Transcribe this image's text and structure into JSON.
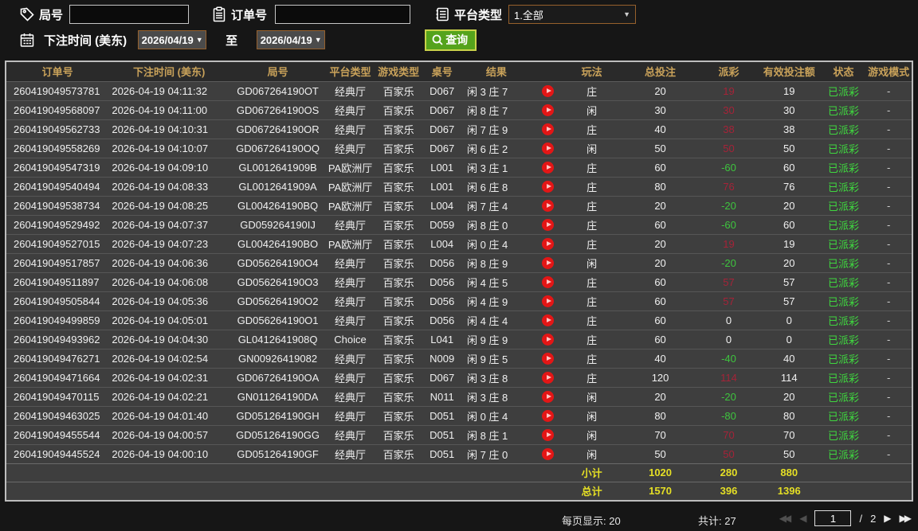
{
  "filters": {
    "round_label": "局号",
    "round_value": "",
    "order_label": "订单号",
    "order_value": "",
    "platform_label": "平台类型",
    "platform_value": "1.全部",
    "bet_time_label": "下注时间 (美东)",
    "date_from": "2026/04/19",
    "to_label": "至",
    "date_to": "2026/04/19",
    "query_label": "查询"
  },
  "glyphs": {
    "caret": "▼",
    "first": "◀◀",
    "prev": "◀",
    "next": "▶",
    "last": "▶▶"
  },
  "colors": {
    "header_gold": "#c9a25a",
    "status_green": "#3fd83f",
    "payout_win_red": "#a52338",
    "payout_loss_green": "#3ec43e",
    "summary_yellow": "#e5df25",
    "query_button_green": "#55a31c",
    "query_button_border": "#c9d24a",
    "picker_border_brown": "#96602c",
    "play_icon_red": "#e31616"
  },
  "table": {
    "columns": [
      "订单号",
      "下注时间 (美东)",
      "局号",
      "平台类型",
      "游戏类型",
      "桌号",
      "结果",
      "",
      "玩法",
      "总投注",
      "派彩",
      "有效投注额",
      "状态",
      "游戏模式"
    ],
    "rows": [
      {
        "order_id": "260419049573781",
        "bet_time": "2026-04-19 04:11:32",
        "round_id": "GD067264190OT",
        "platform": "经典厅",
        "game_type": "百家乐",
        "table_no": "D067",
        "result": "闲 3 庄 7",
        "bet_side": "庄",
        "total_bet": "20",
        "payout": "19",
        "valid_bet": "19",
        "status": "已派彩",
        "mode": "-"
      },
      {
        "order_id": "260419049568097",
        "bet_time": "2026-04-19 04:11:00",
        "round_id": "GD067264190OS",
        "platform": "经典厅",
        "game_type": "百家乐",
        "table_no": "D067",
        "result": "闲 8 庄 7",
        "bet_side": "闲",
        "total_bet": "30",
        "payout": "30",
        "valid_bet": "30",
        "status": "已派彩",
        "mode": "-"
      },
      {
        "order_id": "260419049562733",
        "bet_time": "2026-04-19 04:10:31",
        "round_id": "GD067264190OR",
        "platform": "经典厅",
        "game_type": "百家乐",
        "table_no": "D067",
        "result": "闲 7 庄 9",
        "bet_side": "庄",
        "total_bet": "40",
        "payout": "38",
        "valid_bet": "38",
        "status": "已派彩",
        "mode": "-"
      },
      {
        "order_id": "260419049558269",
        "bet_time": "2026-04-19 04:10:07",
        "round_id": "GD067264190OQ",
        "platform": "经典厅",
        "game_type": "百家乐",
        "table_no": "D067",
        "result": "闲 6 庄 2",
        "bet_side": "闲",
        "total_bet": "50",
        "payout": "50",
        "valid_bet": "50",
        "status": "已派彩",
        "mode": "-"
      },
      {
        "order_id": "260419049547319",
        "bet_time": "2026-04-19 04:09:10",
        "round_id": "GL0012641909B",
        "platform": "PA欧洲厅",
        "game_type": "百家乐",
        "table_no": "L001",
        "result": "闲 3 庄 1",
        "bet_side": "庄",
        "total_bet": "60",
        "payout": "-60",
        "valid_bet": "60",
        "status": "已派彩",
        "mode": "-"
      },
      {
        "order_id": "260419049540494",
        "bet_time": "2026-04-19 04:08:33",
        "round_id": "GL0012641909A",
        "platform": "PA欧洲厅",
        "game_type": "百家乐",
        "table_no": "L001",
        "result": "闲 6 庄 8",
        "bet_side": "庄",
        "total_bet": "80",
        "payout": "76",
        "valid_bet": "76",
        "status": "已派彩",
        "mode": "-"
      },
      {
        "order_id": "260419049538734",
        "bet_time": "2026-04-19 04:08:25",
        "round_id": "GL004264190BQ",
        "platform": "PA欧洲厅",
        "game_type": "百家乐",
        "table_no": "L004",
        "result": "闲 7 庄 4",
        "bet_side": "庄",
        "total_bet": "20",
        "payout": "-20",
        "valid_bet": "20",
        "status": "已派彩",
        "mode": "-"
      },
      {
        "order_id": "260419049529492",
        "bet_time": "2026-04-19 04:07:37",
        "round_id": "GD059264190IJ",
        "platform": "经典厅",
        "game_type": "百家乐",
        "table_no": "D059",
        "result": "闲 8 庄 0",
        "bet_side": "庄",
        "total_bet": "60",
        "payout": "-60",
        "valid_bet": "60",
        "status": "已派彩",
        "mode": "-"
      },
      {
        "order_id": "260419049527015",
        "bet_time": "2026-04-19 04:07:23",
        "round_id": "GL004264190BO",
        "platform": "PA欧洲厅",
        "game_type": "百家乐",
        "table_no": "L004",
        "result": "闲 0 庄 4",
        "bet_side": "庄",
        "total_bet": "20",
        "payout": "19",
        "valid_bet": "19",
        "status": "已派彩",
        "mode": "-"
      },
      {
        "order_id": "260419049517857",
        "bet_time": "2026-04-19 04:06:36",
        "round_id": "GD056264190O4",
        "platform": "经典厅",
        "game_type": "百家乐",
        "table_no": "D056",
        "result": "闲 8 庄 9",
        "bet_side": "闲",
        "total_bet": "20",
        "payout": "-20",
        "valid_bet": "20",
        "status": "已派彩",
        "mode": "-"
      },
      {
        "order_id": "260419049511897",
        "bet_time": "2026-04-19 04:06:08",
        "round_id": "GD056264190O3",
        "platform": "经典厅",
        "game_type": "百家乐",
        "table_no": "D056",
        "result": "闲 4 庄 5",
        "bet_side": "庄",
        "total_bet": "60",
        "payout": "57",
        "valid_bet": "57",
        "status": "已派彩",
        "mode": "-"
      },
      {
        "order_id": "260419049505844",
        "bet_time": "2026-04-19 04:05:36",
        "round_id": "GD056264190O2",
        "platform": "经典厅",
        "game_type": "百家乐",
        "table_no": "D056",
        "result": "闲 4 庄 9",
        "bet_side": "庄",
        "total_bet": "60",
        "payout": "57",
        "valid_bet": "57",
        "status": "已派彩",
        "mode": "-"
      },
      {
        "order_id": "260419049499859",
        "bet_time": "2026-04-19 04:05:01",
        "round_id": "GD056264190O1",
        "platform": "经典厅",
        "game_type": "百家乐",
        "table_no": "D056",
        "result": "闲 4 庄 4",
        "bet_side": "庄",
        "total_bet": "60",
        "payout": "0",
        "valid_bet": "0",
        "status": "已派彩",
        "mode": "-"
      },
      {
        "order_id": "260419049493962",
        "bet_time": "2026-04-19 04:04:30",
        "round_id": "GL0412641908Q",
        "platform": "Choice",
        "game_type": "百家乐",
        "table_no": "L041",
        "result": "闲 9 庄 9",
        "bet_side": "庄",
        "total_bet": "60",
        "payout": "0",
        "valid_bet": "0",
        "status": "已派彩",
        "mode": "-"
      },
      {
        "order_id": "260419049476271",
        "bet_time": "2026-04-19 04:02:54",
        "round_id": "GN00926419082",
        "platform": "经典厅",
        "game_type": "百家乐",
        "table_no": "N009",
        "result": "闲 9 庄 5",
        "bet_side": "庄",
        "total_bet": "40",
        "payout": "-40",
        "valid_bet": "40",
        "status": "已派彩",
        "mode": "-"
      },
      {
        "order_id": "260419049471664",
        "bet_time": "2026-04-19 04:02:31",
        "round_id": "GD067264190OA",
        "platform": "经典厅",
        "game_type": "百家乐",
        "table_no": "D067",
        "result": "闲 3 庄 8",
        "bet_side": "庄",
        "total_bet": "120",
        "payout": "114",
        "valid_bet": "114",
        "status": "已派彩",
        "mode": "-"
      },
      {
        "order_id": "260419049470115",
        "bet_time": "2026-04-19 04:02:21",
        "round_id": "GN011264190DA",
        "platform": "经典厅",
        "game_type": "百家乐",
        "table_no": "N011",
        "result": "闲 3 庄 8",
        "bet_side": "闲",
        "total_bet": "20",
        "payout": "-20",
        "valid_bet": "20",
        "status": "已派彩",
        "mode": "-"
      },
      {
        "order_id": "260419049463025",
        "bet_time": "2026-04-19 04:01:40",
        "round_id": "GD051264190GH",
        "platform": "经典厅",
        "game_type": "百家乐",
        "table_no": "D051",
        "result": "闲 0 庄 4",
        "bet_side": "闲",
        "total_bet": "80",
        "payout": "-80",
        "valid_bet": "80",
        "status": "已派彩",
        "mode": "-"
      },
      {
        "order_id": "260419049455544",
        "bet_time": "2026-04-19 04:00:57",
        "round_id": "GD051264190GG",
        "platform": "经典厅",
        "game_type": "百家乐",
        "table_no": "D051",
        "result": "闲 8 庄 1",
        "bet_side": "闲",
        "total_bet": "70",
        "payout": "70",
        "valid_bet": "70",
        "status": "已派彩",
        "mode": "-"
      },
      {
        "order_id": "260419049445524",
        "bet_time": "2026-04-19 04:00:10",
        "round_id": "GD051264190GF",
        "platform": "经典厅",
        "game_type": "百家乐",
        "table_no": "D051",
        "result": "闲 7 庄 0",
        "bet_side": "闲",
        "total_bet": "50",
        "payout": "50",
        "valid_bet": "50",
        "status": "已派彩",
        "mode": "-"
      }
    ],
    "subtotal": {
      "label": "小计",
      "total_bet": "1020",
      "payout": "280",
      "valid_bet": "880"
    },
    "total": {
      "label": "总计",
      "total_bet": "1570",
      "payout": "396",
      "valid_bet": "1396"
    }
  },
  "footer": {
    "page_size_label": "每页显示: 20",
    "total_count_label": "共计: 27",
    "current_page": "1",
    "page_separator": "/",
    "total_pages": "2"
  }
}
